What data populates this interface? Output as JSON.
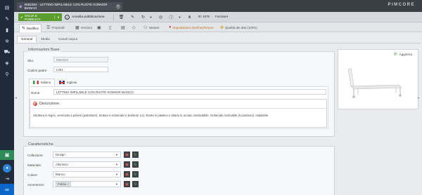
{
  "sidebar": {
    "icons": [
      "document-icon",
      "wrench-icon",
      "chart-icon",
      "settings-icon",
      "cart-icon",
      "box-icon",
      "search-icon"
    ]
  },
  "topbar": {
    "tab_label": "0662284 - LETTINO IMPILABILE CON RUOTE KONNOR BIANCO",
    "brand": "PIMCORE"
  },
  "toolbar": {
    "save_label": "SALVA E PUBBLICA",
    "unpublish_label": "Annulla pubblicazione",
    "id_label": "ID 1976",
    "type_label": "Furniture"
  },
  "subbar": {
    "edit": "Modifica",
    "properties": "Proprietà",
    "versions": "Versioni",
    "variants": "Varianti",
    "symfony": "Impostazioni SymfonyFimore",
    "quality": "Qualità dei dati (100%)"
  },
  "inner_tabs": [
    "General",
    "Media",
    "Canali output"
  ],
  "base_info": {
    "legend": "Informazioni Base",
    "sku_label": "Sku:",
    "sku_value": "0662284",
    "supplier_code_label": "Codice padre:",
    "supplier_code_value": "L001",
    "lang_tabs": [
      "Italiano",
      "Inglese"
    ],
    "name_label": "Nome:",
    "name_value": "LETTINO IMPILABILE CON RUOTE KONNOR BIANCO",
    "desc_label": "Descrizione",
    "desc_text": "Struttura in legno, verniciato a polveri (poliestere). Seduta e schienale in textilene 1x1. Ruote in plastica e ottone in acciaio inossidabile. Schienale reclinabile (6 posizioni). Impilabile."
  },
  "preview": {
    "refresh_label": "Aggiorna"
  },
  "characteristics": {
    "legend": "Caratteristiche",
    "rows": [
      {
        "label": "Collezione:",
        "value": "Design"
      },
      {
        "label": "Materiale:",
        "value": "Alluminio"
      },
      {
        "label": "Colore:",
        "value": "Bianco"
      },
      {
        "label": "Avvertenze:",
        "value": "Pulizia"
      }
    ]
  }
}
